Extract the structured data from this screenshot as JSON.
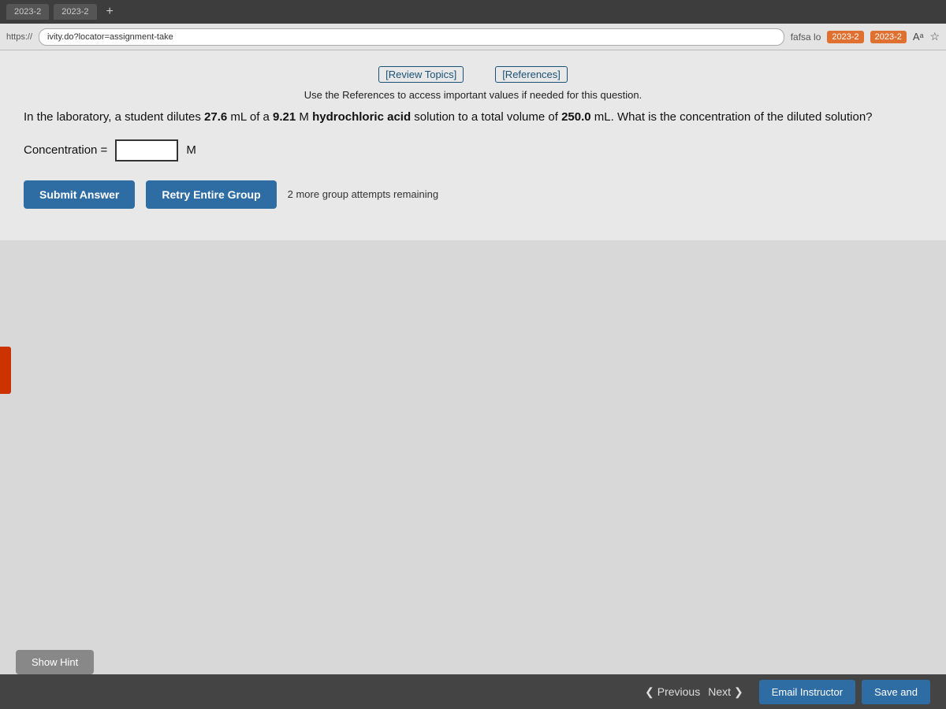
{
  "browser": {
    "url": "ivity.do?locator=assignment-take",
    "tab1": "2023-2",
    "tab2": "2023-2",
    "fafsa_label": "fafsa lo",
    "https_label": "https://",
    "plus_label": "+",
    "font_size_label": "Aᵃ",
    "settings_icon": "☆"
  },
  "toolbar": {
    "review_topics_label": "[Review Topics]",
    "references_label": "[References]"
  },
  "question": {
    "text_part1": "In the laboratory, a student dilutes ",
    "bold_volume": "27.6",
    "text_part2": " mL of a ",
    "bold_molarity": "9.21",
    "text_part3": " M ",
    "bold_acid": "hydrochloric acid",
    "text_part4": " solution to a total volume of ",
    "bold_total_vol": "250.0",
    "text_part5": " mL. What is the concentration of the diluted solution?",
    "concentration_label": "Concentration =",
    "unit_label": "M",
    "input_value": ""
  },
  "buttons": {
    "submit_answer": "Submit Answer",
    "retry_entire_group": "Retry Entire Group",
    "attempts_text": "2 more group attempts remaining",
    "show_hint": "Show Hint"
  },
  "bottom_nav": {
    "previous_label": "Previous",
    "next_label": "Next",
    "email_instructor_label": "Email Instructor",
    "save_and_label": "Save and"
  }
}
